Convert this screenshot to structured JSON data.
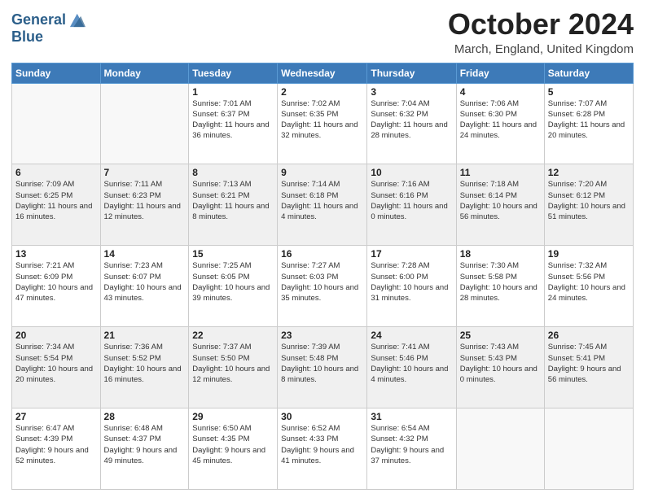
{
  "logo": {
    "line1": "General",
    "line2": "Blue"
  },
  "title": "October 2024",
  "subtitle": "March, England, United Kingdom",
  "days_header": [
    "Sunday",
    "Monday",
    "Tuesday",
    "Wednesday",
    "Thursday",
    "Friday",
    "Saturday"
  ],
  "weeks": [
    [
      {
        "num": "",
        "info": ""
      },
      {
        "num": "",
        "info": ""
      },
      {
        "num": "1",
        "info": "Sunrise: 7:01 AM\nSunset: 6:37 PM\nDaylight: 11 hours and 36 minutes."
      },
      {
        "num": "2",
        "info": "Sunrise: 7:02 AM\nSunset: 6:35 PM\nDaylight: 11 hours and 32 minutes."
      },
      {
        "num": "3",
        "info": "Sunrise: 7:04 AM\nSunset: 6:32 PM\nDaylight: 11 hours and 28 minutes."
      },
      {
        "num": "4",
        "info": "Sunrise: 7:06 AM\nSunset: 6:30 PM\nDaylight: 11 hours and 24 minutes."
      },
      {
        "num": "5",
        "info": "Sunrise: 7:07 AM\nSunset: 6:28 PM\nDaylight: 11 hours and 20 minutes."
      }
    ],
    [
      {
        "num": "6",
        "info": "Sunrise: 7:09 AM\nSunset: 6:25 PM\nDaylight: 11 hours and 16 minutes."
      },
      {
        "num": "7",
        "info": "Sunrise: 7:11 AM\nSunset: 6:23 PM\nDaylight: 11 hours and 12 minutes."
      },
      {
        "num": "8",
        "info": "Sunrise: 7:13 AM\nSunset: 6:21 PM\nDaylight: 11 hours and 8 minutes."
      },
      {
        "num": "9",
        "info": "Sunrise: 7:14 AM\nSunset: 6:18 PM\nDaylight: 11 hours and 4 minutes."
      },
      {
        "num": "10",
        "info": "Sunrise: 7:16 AM\nSunset: 6:16 PM\nDaylight: 11 hours and 0 minutes."
      },
      {
        "num": "11",
        "info": "Sunrise: 7:18 AM\nSunset: 6:14 PM\nDaylight: 10 hours and 56 minutes."
      },
      {
        "num": "12",
        "info": "Sunrise: 7:20 AM\nSunset: 6:12 PM\nDaylight: 10 hours and 51 minutes."
      }
    ],
    [
      {
        "num": "13",
        "info": "Sunrise: 7:21 AM\nSunset: 6:09 PM\nDaylight: 10 hours and 47 minutes."
      },
      {
        "num": "14",
        "info": "Sunrise: 7:23 AM\nSunset: 6:07 PM\nDaylight: 10 hours and 43 minutes."
      },
      {
        "num": "15",
        "info": "Sunrise: 7:25 AM\nSunset: 6:05 PM\nDaylight: 10 hours and 39 minutes."
      },
      {
        "num": "16",
        "info": "Sunrise: 7:27 AM\nSunset: 6:03 PM\nDaylight: 10 hours and 35 minutes."
      },
      {
        "num": "17",
        "info": "Sunrise: 7:28 AM\nSunset: 6:00 PM\nDaylight: 10 hours and 31 minutes."
      },
      {
        "num": "18",
        "info": "Sunrise: 7:30 AM\nSunset: 5:58 PM\nDaylight: 10 hours and 28 minutes."
      },
      {
        "num": "19",
        "info": "Sunrise: 7:32 AM\nSunset: 5:56 PM\nDaylight: 10 hours and 24 minutes."
      }
    ],
    [
      {
        "num": "20",
        "info": "Sunrise: 7:34 AM\nSunset: 5:54 PM\nDaylight: 10 hours and 20 minutes."
      },
      {
        "num": "21",
        "info": "Sunrise: 7:36 AM\nSunset: 5:52 PM\nDaylight: 10 hours and 16 minutes."
      },
      {
        "num": "22",
        "info": "Sunrise: 7:37 AM\nSunset: 5:50 PM\nDaylight: 10 hours and 12 minutes."
      },
      {
        "num": "23",
        "info": "Sunrise: 7:39 AM\nSunset: 5:48 PM\nDaylight: 10 hours and 8 minutes."
      },
      {
        "num": "24",
        "info": "Sunrise: 7:41 AM\nSunset: 5:46 PM\nDaylight: 10 hours and 4 minutes."
      },
      {
        "num": "25",
        "info": "Sunrise: 7:43 AM\nSunset: 5:43 PM\nDaylight: 10 hours and 0 minutes."
      },
      {
        "num": "26",
        "info": "Sunrise: 7:45 AM\nSunset: 5:41 PM\nDaylight: 9 hours and 56 minutes."
      }
    ],
    [
      {
        "num": "27",
        "info": "Sunrise: 6:47 AM\nSunset: 4:39 PM\nDaylight: 9 hours and 52 minutes."
      },
      {
        "num": "28",
        "info": "Sunrise: 6:48 AM\nSunset: 4:37 PM\nDaylight: 9 hours and 49 minutes."
      },
      {
        "num": "29",
        "info": "Sunrise: 6:50 AM\nSunset: 4:35 PM\nDaylight: 9 hours and 45 minutes."
      },
      {
        "num": "30",
        "info": "Sunrise: 6:52 AM\nSunset: 4:33 PM\nDaylight: 9 hours and 41 minutes."
      },
      {
        "num": "31",
        "info": "Sunrise: 6:54 AM\nSunset: 4:32 PM\nDaylight: 9 hours and 37 minutes."
      },
      {
        "num": "",
        "info": ""
      },
      {
        "num": "",
        "info": ""
      }
    ]
  ]
}
